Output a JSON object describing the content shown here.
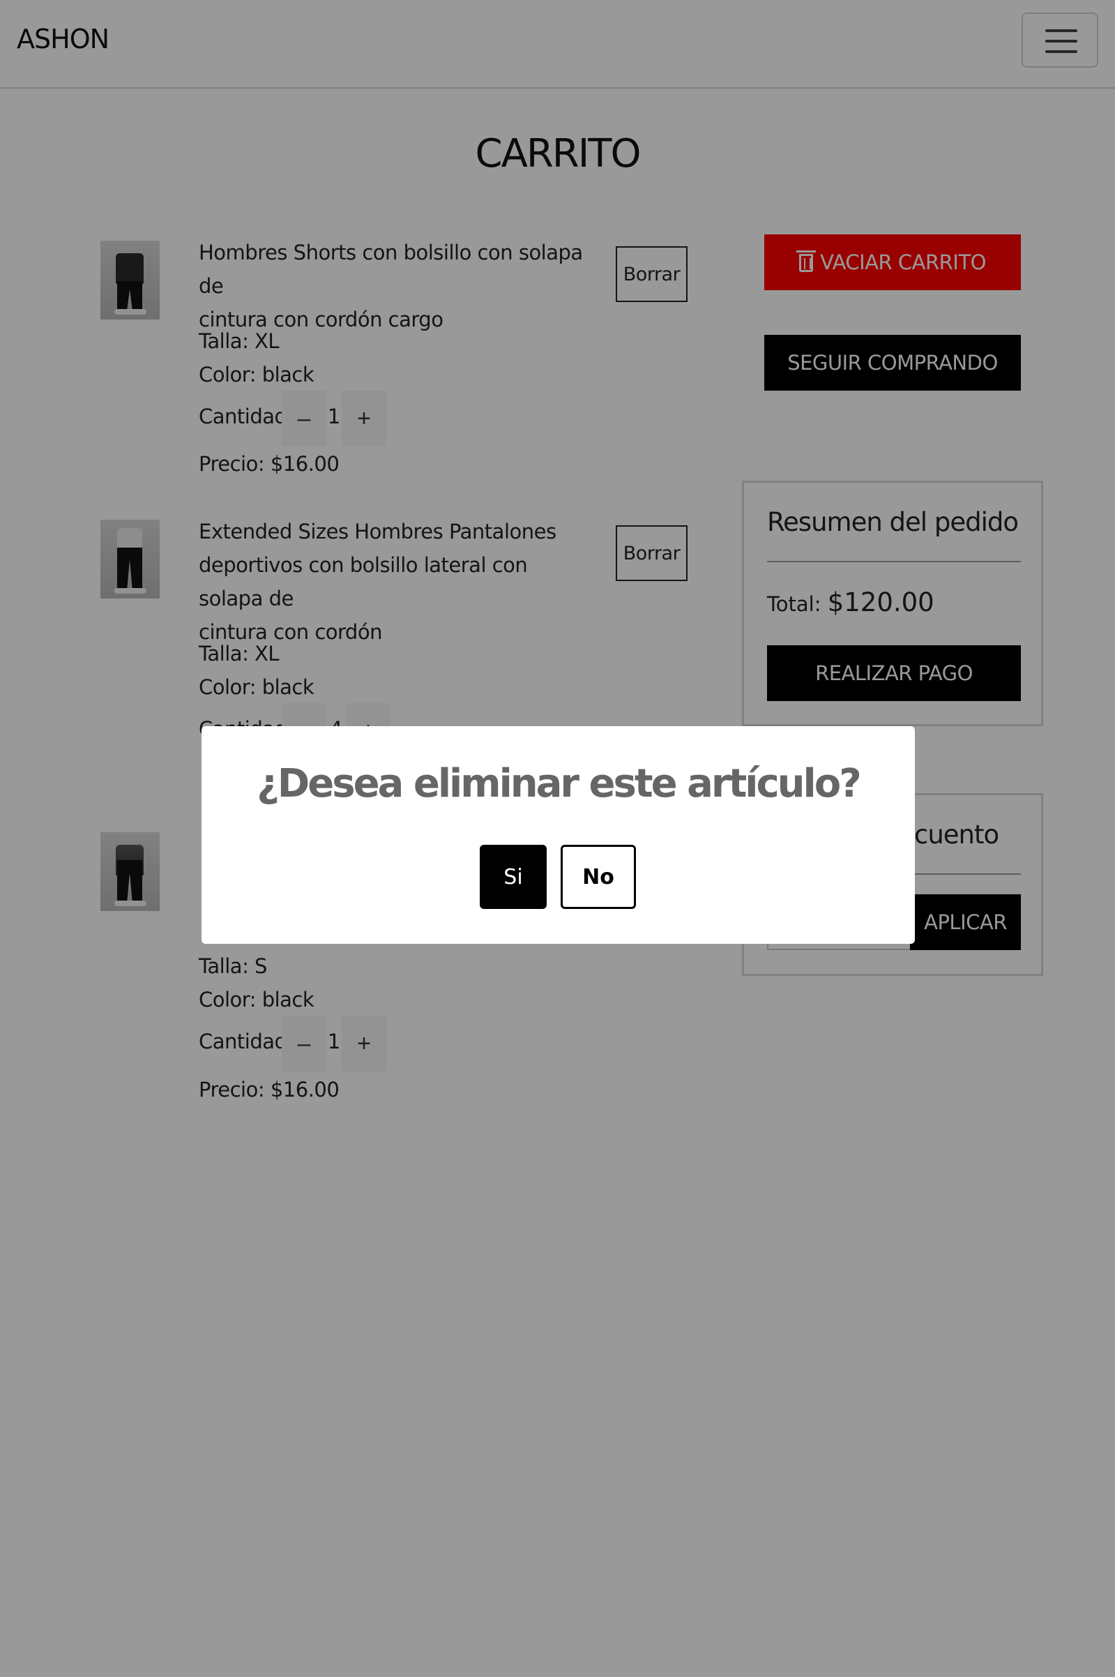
{
  "navbar": {
    "brand": "ASHON",
    "menu_icon": "hamburger-menu-icon"
  },
  "page_title": "CARRITO",
  "labels": {
    "talla": "Talla:",
    "color": "Color:",
    "cantidad": "Cantidad:",
    "precio": "Precio:",
    "delete": "Borrar",
    "minus": "–",
    "plus": "+"
  },
  "items": [
    {
      "name_line1": "Hombres Shorts con bolsillo con solapa de",
      "name_line2": "cintura con cordón cargo",
      "name_line3": "",
      "talla": "Talla: XL",
      "color": "Color: black",
      "qty": "1",
      "price": "Precio: $16.00"
    },
    {
      "name_line1": "Extended Sizes Hombres Pantalones",
      "name_line2": "deportivos con bolsillo lateral con solapa de",
      "name_line3": "cintura con cordón",
      "talla": "Talla: XL",
      "color": "Color: black",
      "qty": "4",
      "price": ""
    },
    {
      "name_line1": "",
      "name_line2": "",
      "name_line3": "",
      "talla": "Talla: S",
      "color": "Color: black",
      "qty": "1",
      "price": "Precio: $16.00"
    }
  ],
  "actions": {
    "empty_cart": "VACIAR CARRITO",
    "continue_shopping": "SEGUIR COMPRANDO"
  },
  "summary": {
    "title": "Resumen del pedido",
    "total_label": "Total:",
    "total_value": "$120.00",
    "pay_button": "REALIZAR PAGO"
  },
  "coupon": {
    "title_visible": "cuento",
    "apply_button": "APLICAR"
  },
  "modal": {
    "title": "¿Desea eliminar este artículo?",
    "yes": "Si",
    "no": "No"
  },
  "colors": {
    "danger": "#ff0000",
    "primary": "#000000",
    "overlay": "rgba(0,0,0,0.4)"
  }
}
